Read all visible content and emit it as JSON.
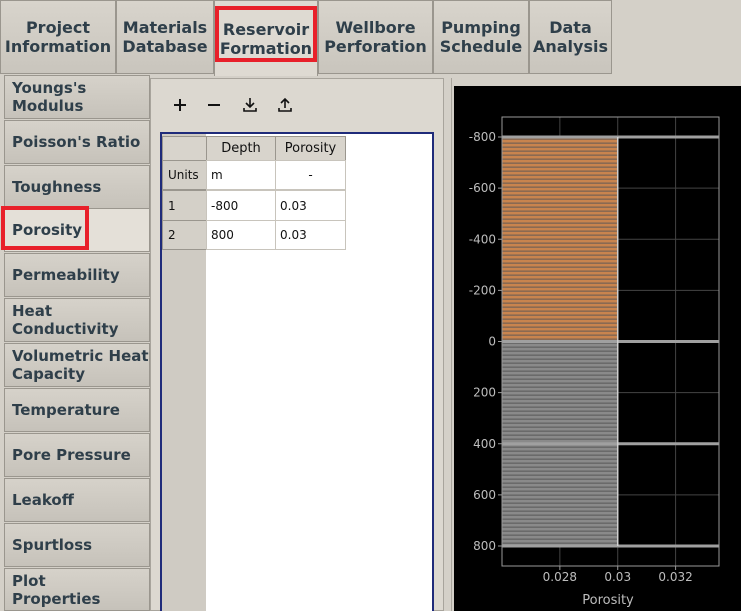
{
  "top_tabs": [
    {
      "label": "Project\nInformation"
    },
    {
      "label": "Materials\nDatabase"
    },
    {
      "label": "Reservoir\nFormation"
    },
    {
      "label": "Wellbore\nPerforation"
    },
    {
      "label": "Pumping\nSchedule"
    },
    {
      "label": "Data\nAnalysis"
    }
  ],
  "properties": [
    {
      "label": "Youngs's Modulus"
    },
    {
      "label": "Poisson's Ratio"
    },
    {
      "label": "Toughness"
    },
    {
      "label": "Porosity"
    },
    {
      "label": "Permeability"
    },
    {
      "label": "Heat Conductivity"
    },
    {
      "label": "Volumetric Heat Capacity"
    },
    {
      "label": "Temperature"
    },
    {
      "label": "Pore Pressure"
    },
    {
      "label": "Leakoff"
    },
    {
      "label": "Spurtloss"
    },
    {
      "label": "Plot\nProperties"
    }
  ],
  "toolbar": {
    "add": "add-icon",
    "remove": "remove-icon",
    "import": "import-icon",
    "export": "export-icon"
  },
  "table": {
    "headers": [
      "Depth",
      "Porosity"
    ],
    "units_label": "Units",
    "units": [
      "m",
      "-"
    ],
    "rows": [
      {
        "index": "1",
        "depth": "-800",
        "porosity": "0.03"
      },
      {
        "index": "2",
        "depth": "800",
        "porosity": "0.03"
      }
    ]
  },
  "chart_data": {
    "type": "area",
    "xlabel": "Porosity",
    "xlim": [
      0.026,
      0.0335
    ],
    "ylim": [
      -850,
      850
    ],
    "y_inverted": true,
    "x_ticks": [
      0.028,
      0.03,
      0.032
    ],
    "x_tick_labels": [
      "0.028",
      "0.03",
      "0.032"
    ],
    "y_ticks": [
      -800,
      -600,
      -400,
      -200,
      0,
      200,
      400,
      600,
      800
    ],
    "y_tick_labels": [
      "-800",
      "-600",
      "-400",
      "-200",
      "0",
      "200",
      "400",
      "600",
      "800"
    ],
    "layers": [
      {
        "top": -800,
        "bottom": 0,
        "porosity": 0.03,
        "color": "#c8844e"
      },
      {
        "top": 0,
        "bottom": 800,
        "porosity": 0.03,
        "color": "#8a8a8a"
      }
    ],
    "boundaries": [
      -800,
      0,
      400,
      800
    ],
    "grid": true,
    "colors": {
      "background": "#000000",
      "axis": "#9a9a9a",
      "grid": "#444444",
      "tick_text": "#bdbdbd"
    }
  }
}
